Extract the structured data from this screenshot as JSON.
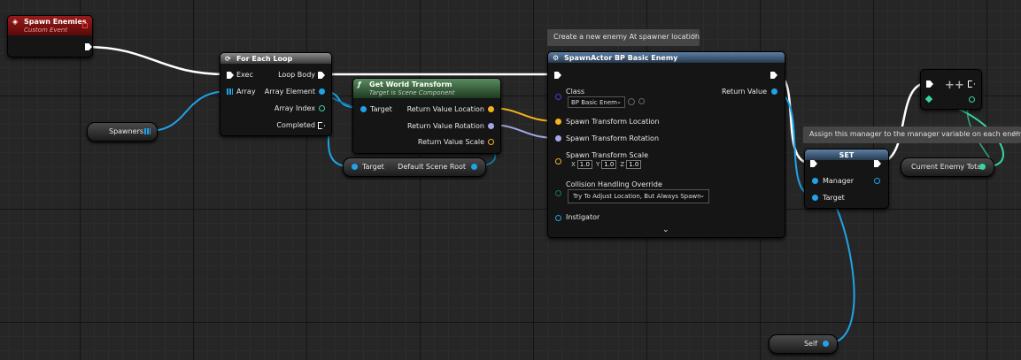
{
  "colors": {
    "exec_wire": "#ffffff",
    "object_pin": "#1fa3e8",
    "vector_pin": "#f5b21e",
    "rotator_pin": "#a3a7e6",
    "int_pin": "#36d6a0",
    "class_pin": "#6a2dd8",
    "struct_pin": "#0d7cb0"
  },
  "nodes": {
    "spawn_enemies": {
      "title": "Spawn Enemies",
      "subtitle": "Custom Event",
      "icon": "event-icon"
    },
    "for_each": {
      "title": "For Each Loop",
      "icon": "loop-icon",
      "exec": "Exec",
      "array": "Array",
      "loop_body": "Loop Body",
      "array_element": "Array Element",
      "array_index": "Array Index",
      "completed": "Completed"
    },
    "spawners": {
      "label": "Spawners"
    },
    "get_world_transform": {
      "title": "Get World Transform",
      "subtitle": "Target is Scene Component",
      "icon": "function-icon",
      "target": "Target",
      "location": "Return Value Location",
      "rotation": "Return Value Rotation",
      "scale": "Return Value Scale"
    },
    "default_scene_root": {
      "target": "Target",
      "label": "Default Scene Root"
    },
    "spawn_actor": {
      "comment": "Create a new enemy At spawner location",
      "title": "SpawnActor BP Basic Enemy",
      "icon": "spawn-icon",
      "class_label": "Class",
      "class_value": "BP Basic Enem",
      "location": "Spawn Transform Location",
      "rotation": "Spawn Transform Rotation",
      "scale": "Spawn Transform Scale",
      "scale_x_label": "X",
      "scale_x": "1.0",
      "scale_y_label": "Y",
      "scale_y": "1.0",
      "scale_z_label": "Z",
      "scale_z": "1.0",
      "collision": "Collision Handling Override",
      "collision_value": "Try To Adjust Location, But Always Spawn",
      "instigator": "Instigator",
      "return_value": "Return Value"
    },
    "set": {
      "comment": "Assign this manager to the manager variable on each enemy",
      "title": "SET",
      "manager": "Manager",
      "target": "Target"
    },
    "increment": {
      "symbol": "++"
    },
    "current_enemy_total": {
      "label": "Current Enemy Total"
    },
    "self": {
      "label": "Self"
    }
  }
}
